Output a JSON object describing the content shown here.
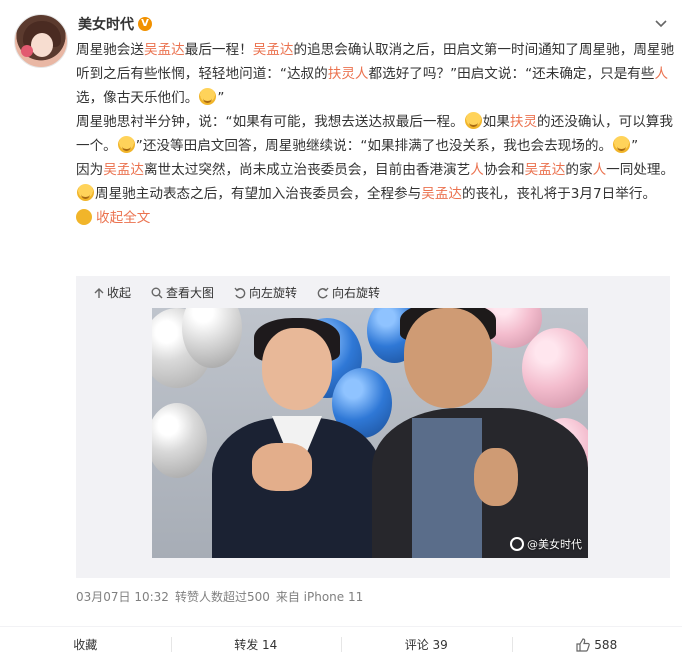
{
  "user": {
    "name": "美女时代",
    "verified_badge": "V"
  },
  "post": {
    "paragraphs": [
      [
        {
          "t": "周星驰会送"
        },
        {
          "t": "吴孟达",
          "hl": true
        },
        {
          "t": "最后一程！"
        },
        {
          "t": "吴孟达",
          "hl": true
        },
        {
          "t": "的追思会确认取消之后，田启文第一时间通知了周星驰，周星驰听到之后有些怅惘，轻轻地问道：“达叔的"
        },
        {
          "t": "扶灵人",
          "hl": true
        },
        {
          "t": "都选好了吗？”田启文说：“还未确定，只是有些"
        },
        {
          "t": "人",
          "hl": true
        },
        {
          "t": "选，像古天乐他们。"
        },
        {
          "emoji": "sad-emoji"
        },
        {
          "t": "”"
        }
      ],
      [
        {
          "t": "周星驰思衬半分钟，说：“如果有可能，我想去送达叔最后一程。"
        },
        {
          "emoji": "sad-emoji"
        },
        {
          "t": "如果"
        },
        {
          "t": "扶灵",
          "hl": true
        },
        {
          "t": "的还没确认，可以算我一个。"
        },
        {
          "emoji": "sad-emoji"
        },
        {
          "t": "”还没等田启文回答，周星驰继续说：“如果排满了也没关系，我也会去现场的。"
        },
        {
          "emoji": "sad-emoji"
        },
        {
          "t": "”"
        }
      ],
      [
        {
          "t": "因为"
        },
        {
          "t": "吴孟达",
          "hl": true
        },
        {
          "t": "离世太过突然，尚未成立治丧委员会，目前由香港演艺"
        },
        {
          "t": "人",
          "hl": true
        },
        {
          "t": "协会和"
        },
        {
          "t": "吴孟达",
          "hl": true
        },
        {
          "t": "的家"
        },
        {
          "t": "人",
          "hl": true
        },
        {
          "t": "一同处理。"
        },
        {
          "emoji": "sad-emoji"
        },
        {
          "t": "周星驰主动表态之后，有望加入治丧委员会，全程参与"
        },
        {
          "t": "吴孟达",
          "hl": true
        },
        {
          "t": "的丧礼，丧礼将于3月7日举行。"
        },
        {
          "expand": "收起全文"
        }
      ]
    ],
    "expand_label": "收起全文"
  },
  "media_toolbar": {
    "collapse": "收起",
    "view_large": "查看大图",
    "rotate_left": "向左旋转",
    "rotate_right": "向右旋转"
  },
  "photo": {
    "watermark": "@美女时代"
  },
  "meta": {
    "time": "03月07日 10:32",
    "reposts_note": "转赞人数超过500",
    "source": "来自 iPhone 11"
  },
  "footer": {
    "favorite": "收藏",
    "repost": "转发 14",
    "comment": "评论 39",
    "like_count": "588"
  },
  "colors": {
    "highlight": "#eb7350",
    "text": "#333333",
    "muted": "#808080",
    "media_bg": "#f2f2f5"
  }
}
